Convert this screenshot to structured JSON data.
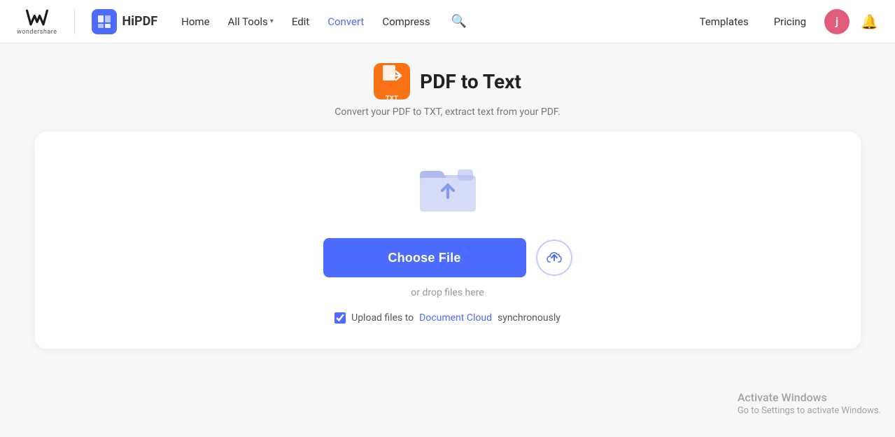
{
  "header": {
    "logo_ws_text": "wondershare",
    "hipdf_label": "HiPDF",
    "nav": {
      "home": "Home",
      "all_tools": "All Tools",
      "edit": "Edit",
      "convert": "Convert",
      "compress": "Compress"
    },
    "right_nav": {
      "templates": "Templates",
      "pricing": "Pricing"
    },
    "user_initial": "j"
  },
  "page": {
    "title": "PDF to Text",
    "subtitle": "Convert your PDF to TXT, extract text from your PDF.",
    "icon_label": "TXT"
  },
  "upload": {
    "choose_file_label": "Choose File",
    "drop_hint": "or drop files here",
    "checkbox_label_before": "Upload files to ",
    "checkbox_link": "Document Cloud",
    "checkbox_label_after": " synchronously",
    "checkbox_checked": true
  },
  "activate_windows": {
    "title": "Activate Windows",
    "subtitle": "Go to Settings to activate Windows."
  }
}
